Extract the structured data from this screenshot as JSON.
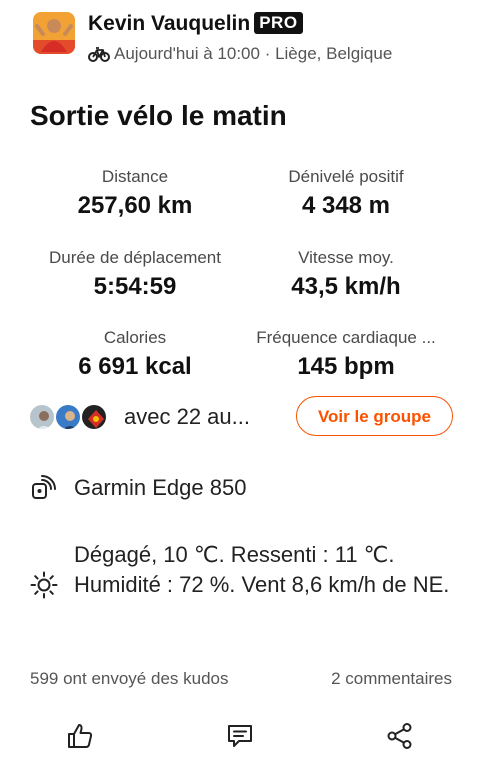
{
  "header": {
    "athlete_name": "Kevin Vauquelin",
    "pro_badge": "PRO",
    "sport_icon": "bike-icon",
    "meta": "Aujourd'hui à 10:00 · Liège, Belgique"
  },
  "activity": {
    "title": "Sortie vélo le matin"
  },
  "stats": [
    {
      "label": "Distance",
      "value": "257,60 km"
    },
    {
      "label": "Dénivelé positif",
      "value": "4 348 m"
    },
    {
      "label": "Durée de déplacement",
      "value": "5:54:59"
    },
    {
      "label": "Vitesse moy.",
      "value": "43,5 km/h"
    },
    {
      "label": "Calories",
      "value": "6 691 kcal"
    },
    {
      "label": "Fréquence cardiaque ...",
      "value": "145 bpm"
    }
  ],
  "group": {
    "text": "avec 22 au...",
    "button_label": "Voir le groupe"
  },
  "device": {
    "icon": "device-icon",
    "name": "Garmin Edge 850"
  },
  "weather": {
    "icon": "sun-icon",
    "text": "Dégagé, 10  ℃. Ressenti : 11  ℃. Humidité : 72 %. Vent 8,6 km/h de NE."
  },
  "social": {
    "kudos": "599 ont envoyé des kudos",
    "comments": "2 commentaires"
  },
  "actions": [
    {
      "icon": "thumbs-up-icon"
    },
    {
      "icon": "comment-icon"
    },
    {
      "icon": "share-icon"
    }
  ],
  "colors": {
    "accent": "#fc5200",
    "text": "#111111",
    "muted": "#555555"
  }
}
